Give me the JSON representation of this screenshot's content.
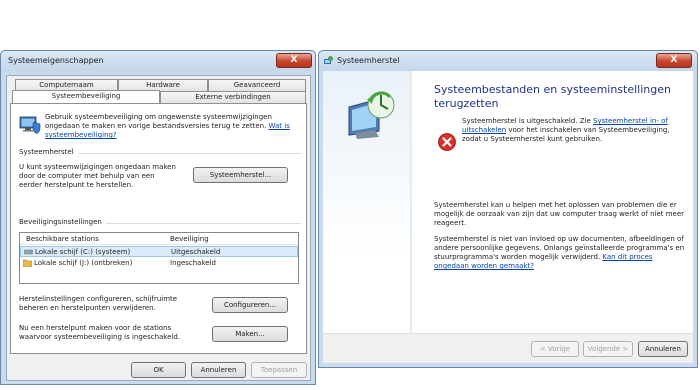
{
  "left_window": {
    "title": "Systeemeigenschappen",
    "close_label": "X",
    "tabs_top": [
      "Computernaam",
      "Hardware",
      "Geavanceerd"
    ],
    "tabs_bottom": [
      "Systeembeveiliging",
      "Externe verbindingen"
    ],
    "active_tab": "Systeembeveiliging",
    "intro_text": "Gebruik systeembeveiliging om ongewenste systeemwijzigingen ongedaan te maken en vorige bestandsversies terug te zetten.",
    "intro_link": "Wat is systeembeveiliging?",
    "restore_group_title": "Systeemherstel",
    "restore_text": "U kunt systeemwijzigingen ongedaan maken door de computer met behulp van een eerder herstelpunt te herstellen.",
    "restore_button": "Systeemherstel...",
    "protection_group_title": "Beveiligingsinstellingen",
    "list_headers": [
      "Beschikbare stations",
      "Beveiliging"
    ],
    "drives": [
      {
        "name": "Lokale schijf (C:) (systeem)",
        "status": "Uitgeschakeld"
      },
      {
        "name": "Lokale schijf (J:) (ontbreken)",
        "status": "Ingeschakeld"
      }
    ],
    "configure_text": "Herstelinstellingen configureren, schijfruimte beheren en herstelpunten verwijderen.",
    "configure_button": "Configureren...",
    "create_text": "Nu een herstelpunt maken voor de stations waarvoor systeembeveiliging is ingeschakeld.",
    "create_button": "Maken...",
    "ok_button": "OK",
    "cancel_button": "Annuleren",
    "apply_button": "Toepassen"
  },
  "right_window": {
    "title": "Systeemherstel",
    "close_label": "X",
    "heading": "Systeembestanden en systeeminstellingen terugzetten",
    "disabled_text_before": "Systeemherstel is uitgeschakeld. Zie ",
    "disabled_link": "Systeemherstel in- of uitschakelen",
    "disabled_text_after": " voor het inschakelen van Systeembeveiliging, zodat u Systeemherstel kunt gebruiken.",
    "para1": "Systeemherstel kan u helpen met het oplossen van problemen die er mogelijk de oorzaak van zijn dat uw computer traag werkt of niet meer reageert.",
    "para2_text": "Systeemherstel is niet van invloed op uw documenten, afbeeldingen of andere persoonlijke gegevens. Onlangs geïnstalleerde programma's en stuurprogramma's worden mogelijk verwijderd. ",
    "para2_link": "Kan dit proces ongedaan worden gemaakt?",
    "back_button": "< Vorige",
    "next_button": "Volgende >",
    "cancel_button": "Annuleren"
  }
}
